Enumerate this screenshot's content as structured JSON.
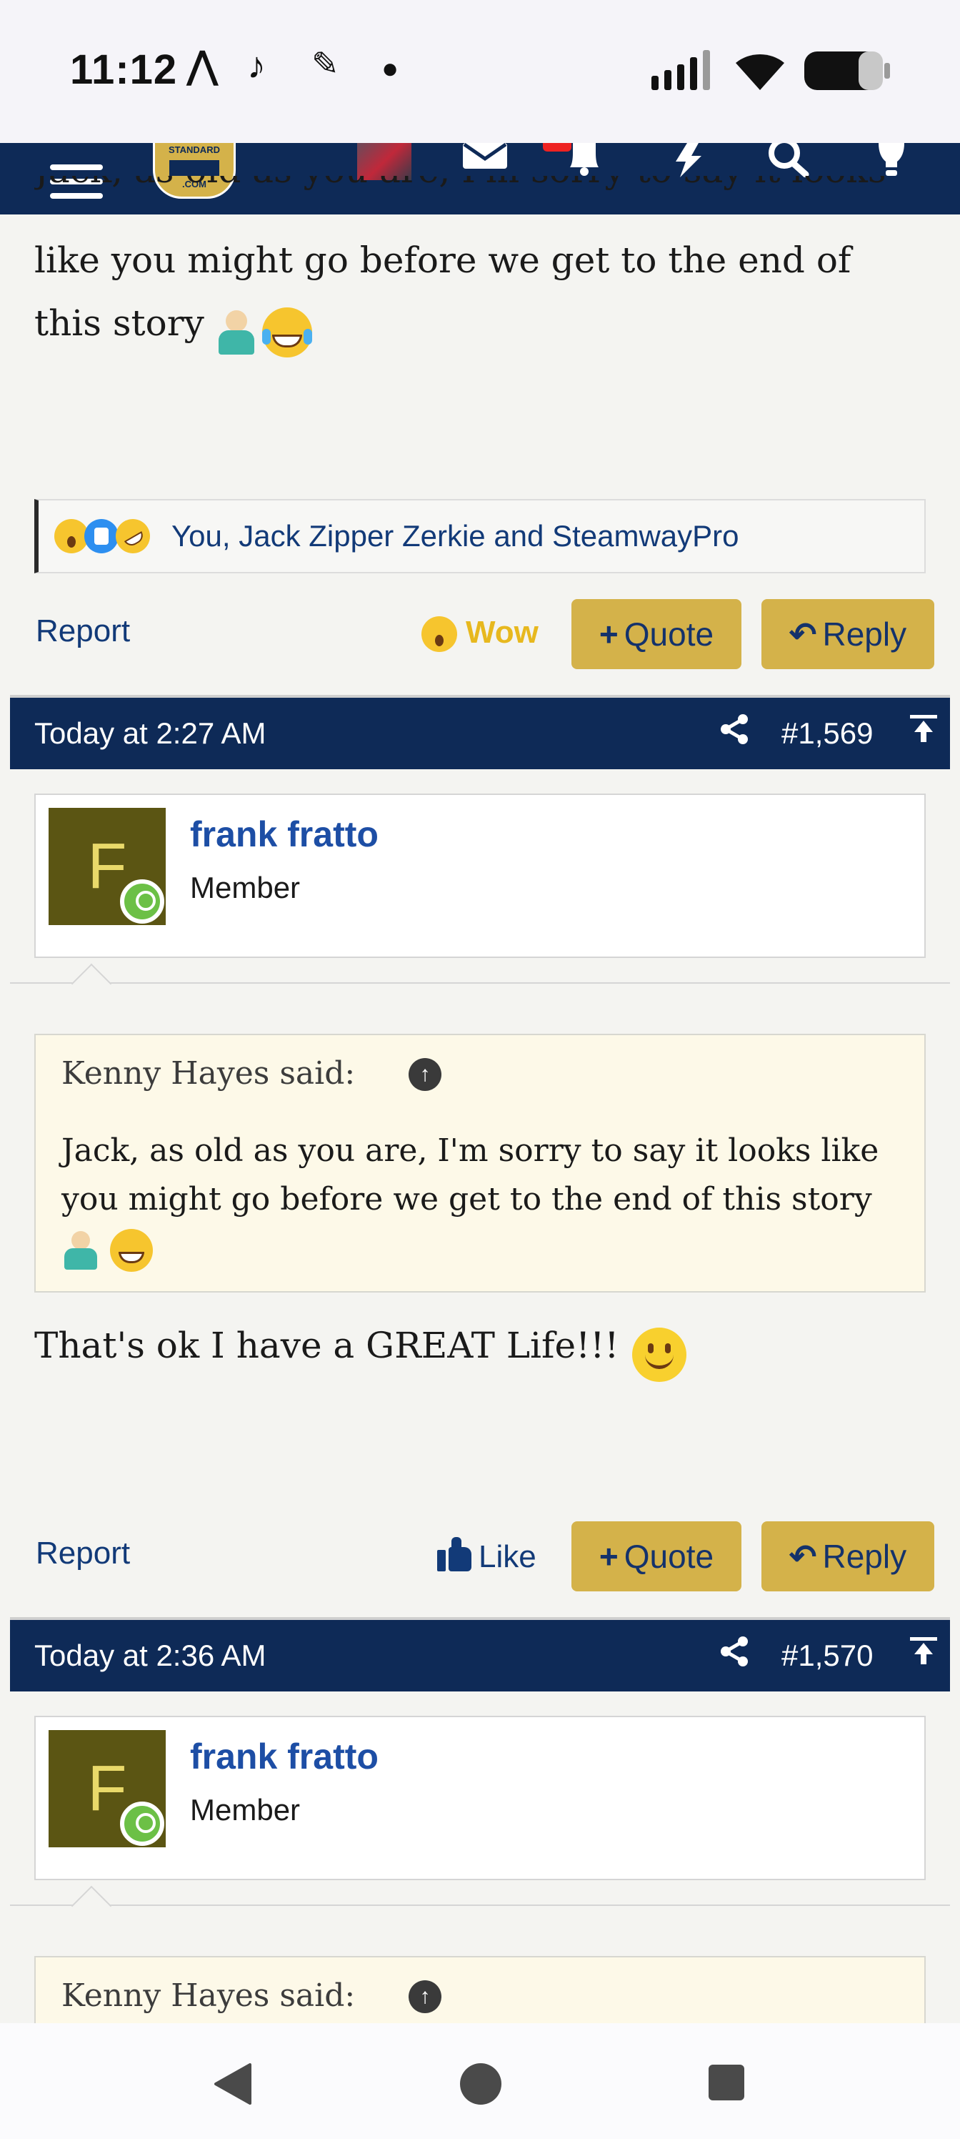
{
  "status_bar": {
    "time": "11:12",
    "icons_left": [
      "a-logo-icon",
      "tiktok-icon",
      "feather-icon",
      "dot-icon"
    ],
    "icons_right": [
      "signal-icon",
      "wifi-icon",
      "battery-icon"
    ]
  },
  "top_nav": {
    "logo_top": "STANDARD",
    "logo_bottom": ".COM",
    "icons": [
      "menu-icon",
      "avatar-thumb",
      "mail-icon",
      "bell-icon",
      "bolt-icon",
      "search-icon",
      "lightbulb-icon"
    ]
  },
  "post_prev": {
    "body_partial": "Jack, as old as you are, I'm sorry to say it looks",
    "body_line1": "like you might go before we get to the end of",
    "body_line2": "this story",
    "reactions_text": "You, Jack Zipper Zerkie and SteamwayPro",
    "report": "Report",
    "wow": "Wow",
    "quote": "Quote",
    "reply": "Reply"
  },
  "post_1569": {
    "time": "Today at 2:27 AM",
    "number": "#1,569",
    "user": {
      "initial": "F",
      "name": "frank fratto",
      "title": "Member"
    },
    "quote_attr": "Kenny Hayes said:",
    "quote_line1": "Jack, as old as you are, I'm sorry to say it looks like",
    "quote_line2": "you might go before we get to the end of this story",
    "body": "That's ok I have a GREAT Life!!!",
    "report": "Report",
    "like": "Like",
    "quote": "Quote",
    "reply": "Reply"
  },
  "post_1570": {
    "time": "Today at 2:36 AM",
    "number": "#1,570",
    "user": {
      "initial": "F",
      "name": "frank fratto",
      "title": "Member"
    },
    "quote_attr": "Kenny Hayes said:"
  }
}
